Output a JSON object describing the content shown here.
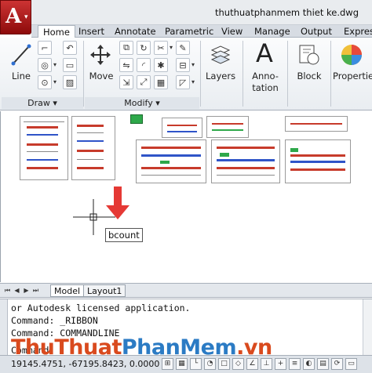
{
  "window": {
    "title": "thuthuatphanmem thiet ke.dwg"
  },
  "app_button": {
    "icon": "autocad-logo-icon",
    "brand_color": "#b71c1c"
  },
  "tabs": [
    {
      "label": "Home",
      "active": true
    },
    {
      "label": "Insert"
    },
    {
      "label": "Annotate"
    },
    {
      "label": "Parametric"
    },
    {
      "label": "View"
    },
    {
      "label": "Manage"
    },
    {
      "label": "Output"
    },
    {
      "label": "Express"
    }
  ],
  "ribbon": {
    "draw": {
      "label": "Draw",
      "line_label": "Line"
    },
    "modify": {
      "label": "Modify",
      "move_label": "Move"
    },
    "layers_label": "Layers",
    "annotation": {
      "line1": "Anno-",
      "line2": "tation",
      "letter": "A"
    },
    "block_label": "Block",
    "properties_label": "Properties"
  },
  "canvas": {
    "command_input": "bcount",
    "arrow_color": "#e53935"
  },
  "layout_tabs": [
    {
      "label": "Model",
      "active": true
    },
    {
      "label": "Layout1"
    }
  ],
  "command_history": [
    "or Autodesk licensed application.",
    "Command: _RIBBON",
    "Command: COMMANDLINE",
    "Command:"
  ],
  "status": {
    "coordinates": "19145.4751, -67195.8423, 0.0000"
  },
  "watermark": {
    "part1": "ThuThuat",
    "part2": "PhanMem",
    "part3": ".vn"
  }
}
